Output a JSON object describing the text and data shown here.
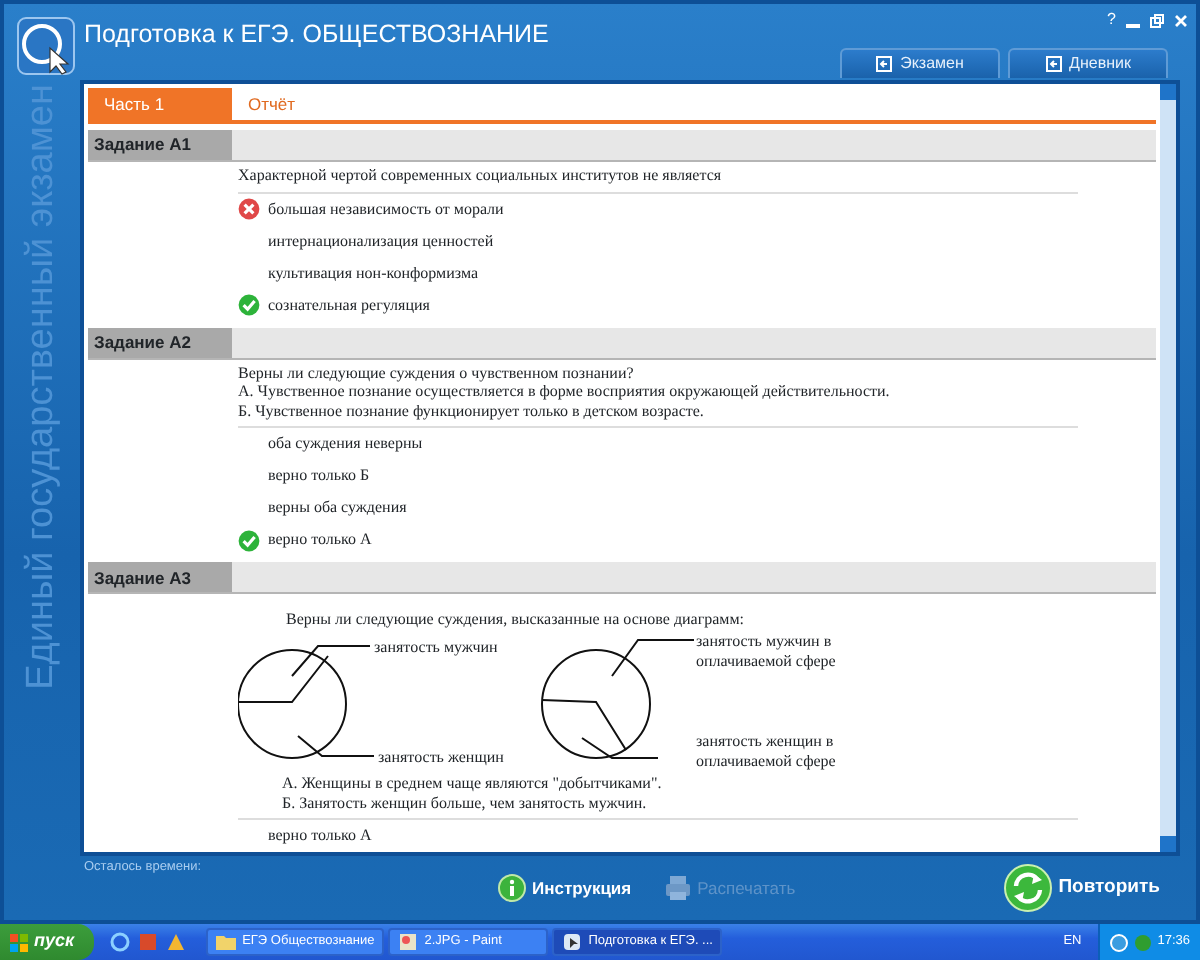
{
  "window": {
    "title": "Подготовка к ЕГЭ. ОБЩЕСТВОЗНАНИЕ",
    "help": "?"
  },
  "top_tabs": [
    {
      "label": "Экзамен"
    },
    {
      "label": "Дневник"
    }
  ],
  "sidebar_caption": "Единый государственный экзамен",
  "part_tabs": [
    {
      "label": "Часть 1",
      "selected": true
    },
    {
      "label": "Отчёт",
      "selected": false
    }
  ],
  "tasks": [
    {
      "title": "Задание А1",
      "question": [
        "Характерной чертой современных социальных институтов не является"
      ],
      "options": [
        {
          "text": "большая независимость от морали",
          "kind": "wrong"
        },
        {
          "text": "интернационализация ценностей",
          "kind": "plain"
        },
        {
          "text": "культивация нон-конформизма",
          "kind": "plain"
        },
        {
          "text": "сознательная регуляция",
          "kind": "correct"
        }
      ]
    },
    {
      "title": "Задание А2",
      "question": [
        "Верны ли следующие суждения о чувственном познании?",
        "А. Чувственное познание осуществляется в форме восприятия окружающей действительности.",
        "Б. Чувственное познание функционирует только в детском возрасте."
      ],
      "options": [
        {
          "text": "оба суждения неверны",
          "kind": "plain"
        },
        {
          "text": "верно только Б",
          "kind": "plain"
        },
        {
          "text": "верны оба суждения",
          "kind": "plain"
        },
        {
          "text": "верно только А",
          "kind": "correct"
        }
      ]
    },
    {
      "title": "Задание А3",
      "question": [
        "Верны ли следующие суждения, высказанные на основе диаграмм:"
      ],
      "diagram": {
        "left_labels": [
          "занятость мужчин",
          "занятость женщин"
        ],
        "right_labels": [
          "занятость мужчин в оплачиваемой сфере",
          "занятость женщин в оплачиваемой сфере"
        ]
      },
      "statements": [
        "А. Женщины в среднем чаще являются \"добытчиками\".",
        "Б. Занятость женщин больше, чем занятость мужчин."
      ],
      "options": [
        {
          "text": "верно только А",
          "kind": "plain"
        }
      ]
    }
  ],
  "footer": {
    "timer_label": "Осталось времени:",
    "buttons": [
      {
        "label": "Инструкция",
        "kind": "info",
        "disabled": false
      },
      {
        "label": "Распечатать",
        "kind": "print",
        "disabled": true
      },
      {
        "label": "Повторить",
        "kind": "repeat",
        "disabled": false
      }
    ]
  },
  "taskbar": {
    "start": "пуск",
    "tasks": [
      {
        "label": "ЕГЭ Обществознание",
        "kind": "folder",
        "selected": false
      },
      {
        "label": "2.JPG - Paint",
        "kind": "paint",
        "selected": false
      },
      {
        "label": "Подготовка к ЕГЭ. ...",
        "kind": "app",
        "selected": true
      }
    ],
    "language": "EN",
    "clock": "17:36"
  }
}
